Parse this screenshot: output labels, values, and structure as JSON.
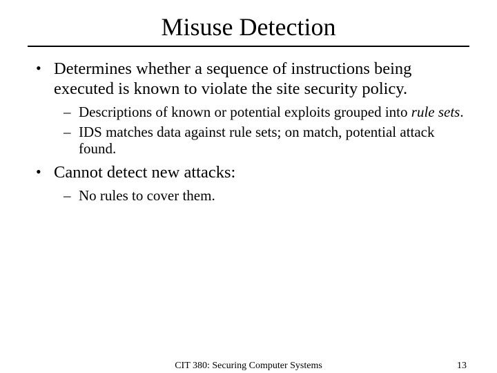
{
  "title": "Misuse Detection",
  "bullets": {
    "b1": "Determines whether a sequence of instructions being executed is known to violate the site security policy.",
    "b1_sub1_a": "Descriptions of known or potential exploits grouped into ",
    "b1_sub1_em": "rule sets",
    "b1_sub1_b": ".",
    "b1_sub2": "IDS matches data against rule sets; on match, potential attack found.",
    "b2": "Cannot detect new attacks:",
    "b2_sub1": "No rules to cover them."
  },
  "footer": {
    "course": "CIT 380: Securing Computer Systems",
    "page": "13"
  }
}
